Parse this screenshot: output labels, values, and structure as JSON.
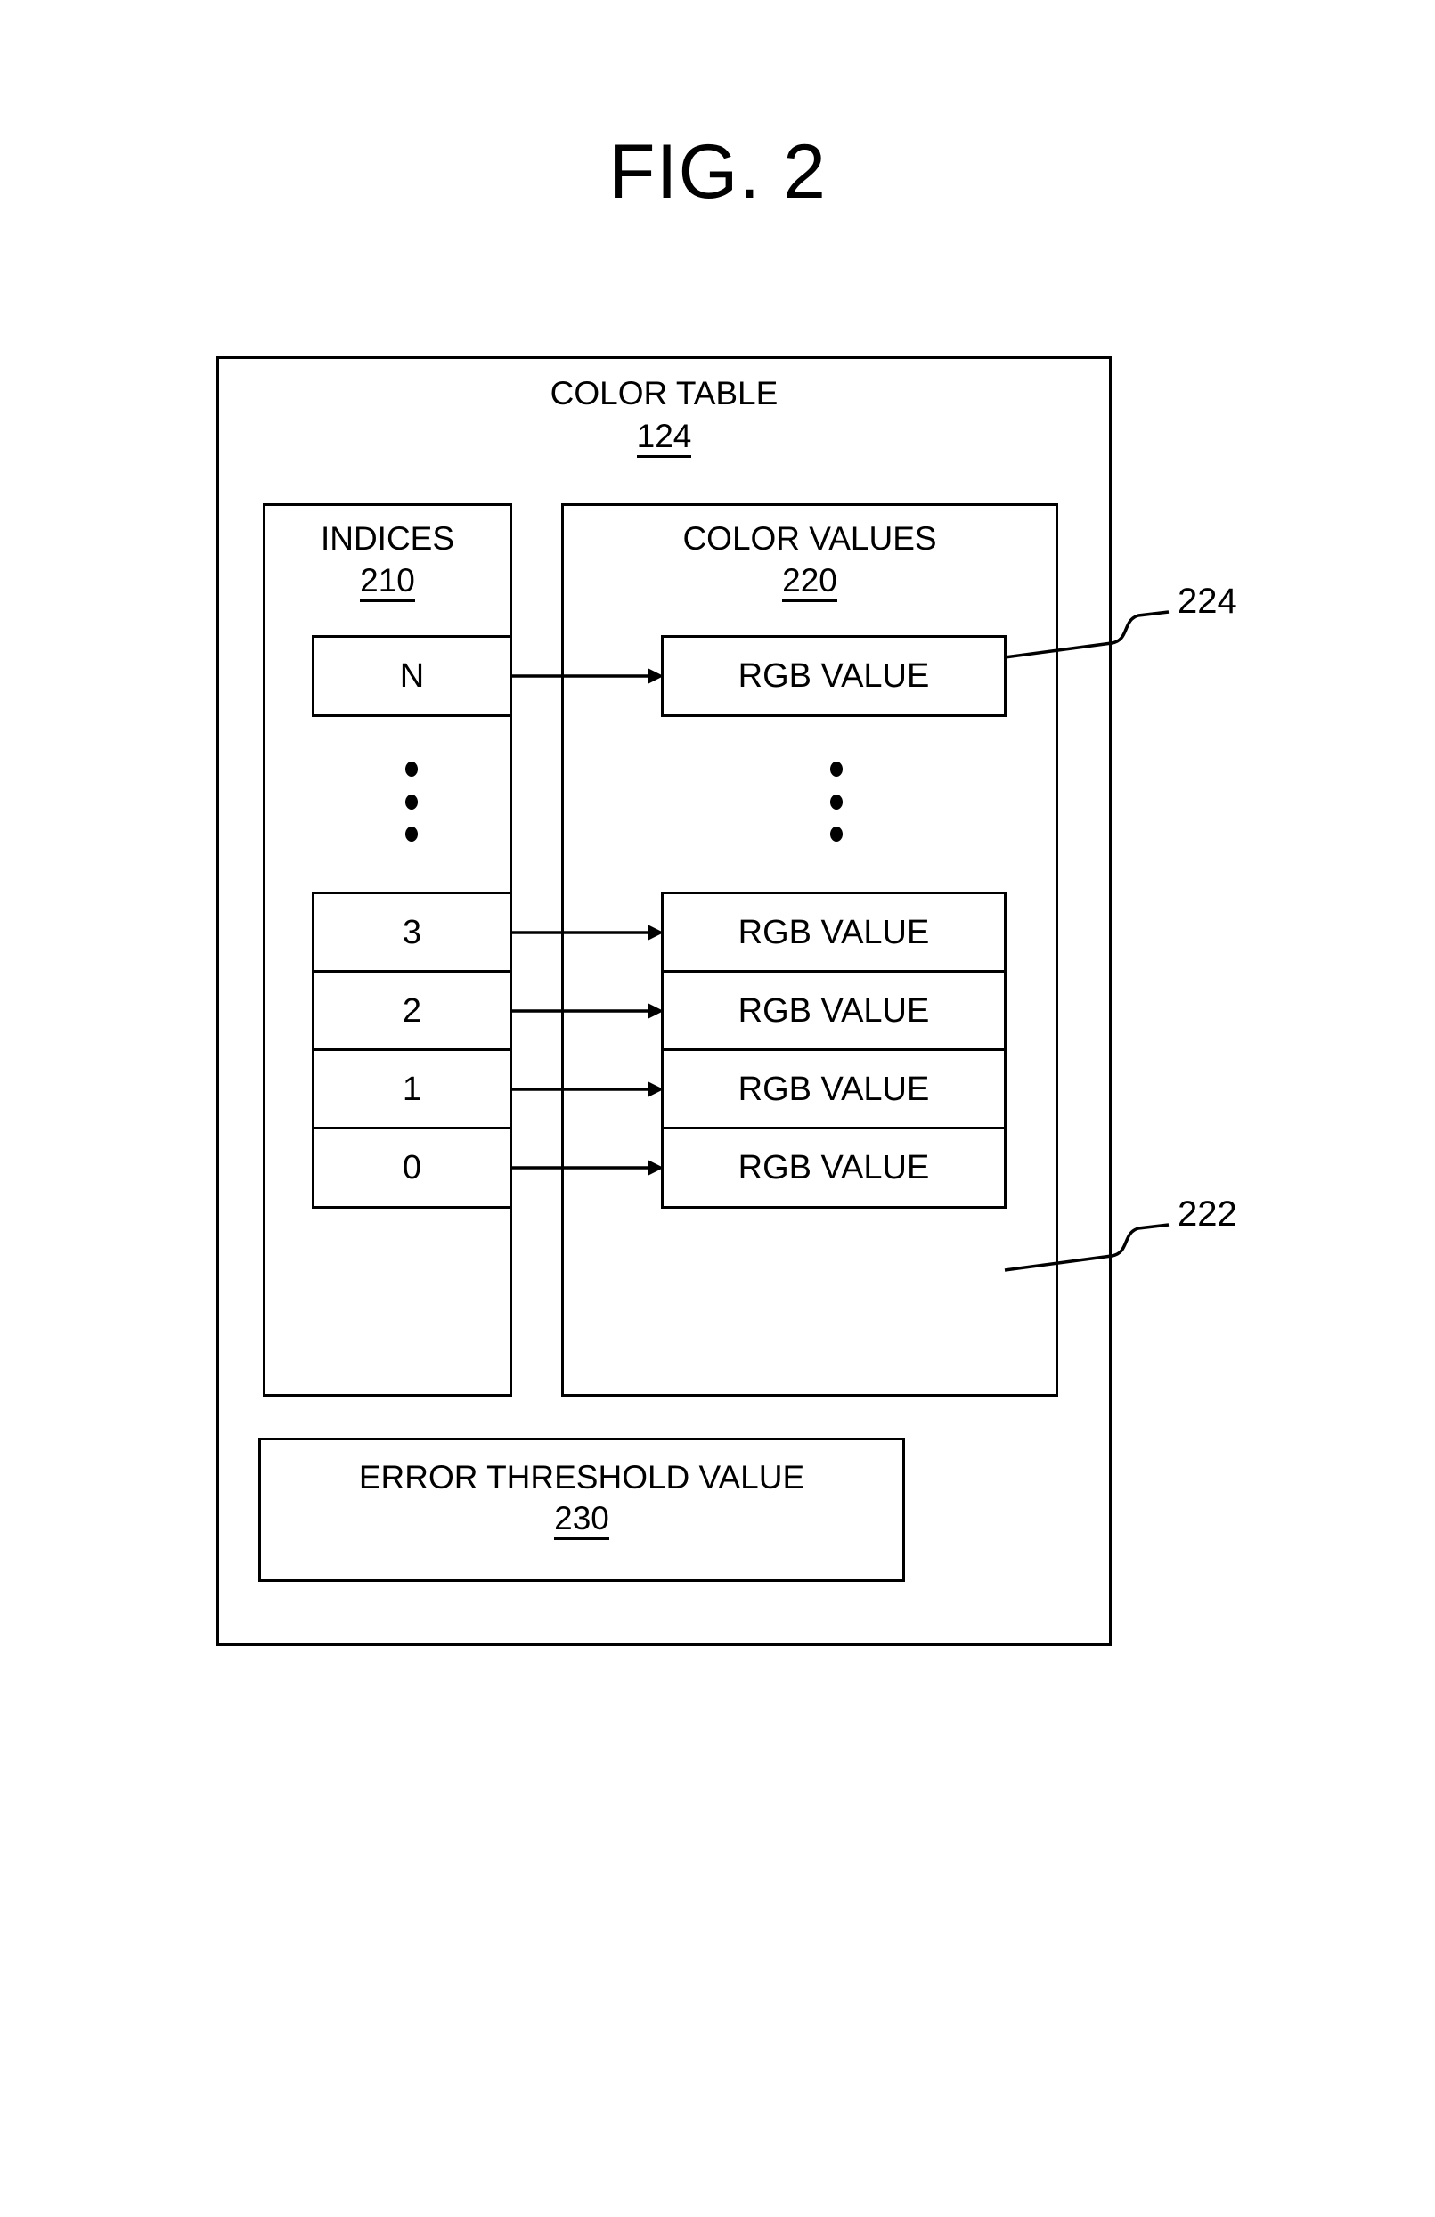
{
  "figure": {
    "title": "FIG. 2"
  },
  "color_table": {
    "label": "COLOR TABLE",
    "ref": "124"
  },
  "indices": {
    "label": "INDICES",
    "ref": "210",
    "cells": [
      {
        "value": "N"
      },
      {
        "value": "3"
      },
      {
        "value": "2"
      },
      {
        "value": "1"
      },
      {
        "value": "0"
      }
    ]
  },
  "color_values": {
    "label": "COLOR VALUES",
    "ref": "220",
    "cells": [
      {
        "value": "RGB VALUE"
      },
      {
        "value": "RGB VALUE"
      },
      {
        "value": "RGB VALUE"
      },
      {
        "value": "RGB VALUE"
      },
      {
        "value": "RGB VALUE"
      }
    ]
  },
  "error_threshold": {
    "label": "ERROR THRESHOLD VALUE",
    "ref": "230"
  },
  "callouts": [
    {
      "id": "224",
      "label": "224"
    },
    {
      "id": "222",
      "label": "222"
    }
  ],
  "ellipsis": {
    "indices_dots": 3,
    "values_dots": 3
  },
  "colors": {
    "ink": "#000000",
    "paper": "#ffffff"
  }
}
